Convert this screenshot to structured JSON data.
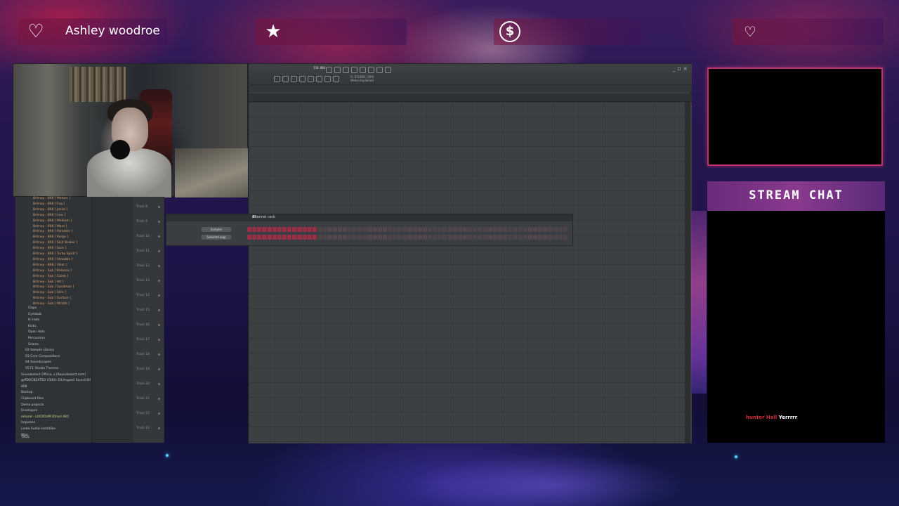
{
  "overlay": {
    "alerts": [
      {
        "icon": "heart-icon",
        "label": "Ashley woodroe"
      },
      {
        "icon": "star-icon",
        "label": ""
      },
      {
        "icon": "dollar-icon",
        "label": ""
      },
      {
        "icon": "heart-hand-icon",
        "label": ""
      }
    ]
  },
  "daw": {
    "bpm_display": "150.000",
    "hint_line1": "FL STUDIO | DPU",
    "hint_line2": "Melon Explained",
    "channel_rack": {
      "title": "Channel rack",
      "filter": "All",
      "channels": [
        {
          "name": "Sampler"
        },
        {
          "name": "Selected loop"
        }
      ]
    },
    "track_labels": [
      "Track 8",
      "Track 9",
      "Track 10",
      "Track 11",
      "Track 12",
      "Track 13",
      "Track 14",
      "Track 15",
      "Track 16",
      "Track 17",
      "Track 18",
      "Track 19",
      "Track 20",
      "Track 21",
      "Track 22",
      "Track 23"
    ],
    "browser_items": [
      {
        "label": "Britney - 808 [ Mature ]",
        "kind": "orange"
      },
      {
        "label": "Britney - 808 [ Fog ]",
        "kind": "orange"
      },
      {
        "label": "Britney - 808 [ Jovial ]",
        "kind": "orange"
      },
      {
        "label": "Britney - 808 [ Low ]",
        "kind": "orange"
      },
      {
        "label": "Britney - 808 [ Medium ]",
        "kind": "orange"
      },
      {
        "label": "Britney - 808 [ Mass ]",
        "kind": "orange"
      },
      {
        "label": "Britney - 808 [ Paradise ]",
        "kind": "orange"
      },
      {
        "label": "Britney - 808 [ Purge ]",
        "kind": "orange"
      },
      {
        "label": "Britney - 808 [ Skill Shaker ]",
        "kind": "orange"
      },
      {
        "label": "Britney - 808 [ Sore ]",
        "kind": "orange"
      },
      {
        "label": "Britney - 808 [ Turbo Spirit ]",
        "kind": "orange"
      },
      {
        "label": "Britney - 808 [ Valuable ]",
        "kind": "orange"
      },
      {
        "label": "Britney - 808 [ Valor ]",
        "kind": "orange"
      },
      {
        "label": "Britney - Sub [ Balance ]",
        "kind": "orange"
      },
      {
        "label": "Britney - Sub [ Comb ]",
        "kind": "orange"
      },
      {
        "label": "Britney - Sub [ Hit ]",
        "kind": "orange"
      },
      {
        "label": "Britney - Sub [ Sandman ]",
        "kind": "orange"
      },
      {
        "label": "Britney - Sub [ Slim ]",
        "kind": "orange"
      },
      {
        "label": "Britney - Sub [ Surface ]",
        "kind": "orange"
      },
      {
        "label": "Britney - Sub [ Wraith ]",
        "kind": "orange"
      },
      {
        "label": "Claps",
        "kind": "white"
      },
      {
        "label": "Cymbals",
        "kind": "white"
      },
      {
        "label": "Hi Hats",
        "kind": "white"
      },
      {
        "label": "Kicks",
        "kind": "white"
      },
      {
        "label": "Open Hats",
        "kind": "white"
      },
      {
        "label": "Percussion",
        "kind": "white"
      },
      {
        "label": "Snares",
        "kind": "white"
      },
      {
        "label": "02 Sample Library",
        "kind": "white"
      },
      {
        "label": "03 Core Compositions",
        "kind": "white"
      },
      {
        "label": "04 Soundscapes",
        "kind": "white"
      },
      {
        "label": "05 FL Studio Themes",
        "kind": "white"
      },
      {
        "label": "Soundselect Officia..s (Roundselect.com)",
        "kind": "white"
      },
      {
        "label": "@PDOCBEATSD 1500+ DLAngstel Sound Kit",
        "kind": "white"
      },
      {
        "label": "808",
        "kind": "white"
      },
      {
        "label": "Backup",
        "kind": "white"
      },
      {
        "label": "Clipboard files",
        "kind": "white"
      },
      {
        "label": "Demo projects",
        "kind": "white"
      },
      {
        "label": "Envelopes",
        "kind": "white"
      },
      {
        "label": "emyral - LOCKDUM [Drum Kit]",
        "kind": "green"
      },
      {
        "label": "Impulses",
        "kind": "white"
      },
      {
        "label": "Linda Audio-InstaVibe",
        "kind": "white"
      },
      {
        "label": "Misc",
        "kind": "white"
      }
    ],
    "browser_footer": "TAGS"
  },
  "chat": {
    "title": "STREAM CHAT",
    "messages": [
      {
        "user": "hunter Hall",
        "text": "Yerrrrr"
      }
    ]
  },
  "colors": {
    "accent_pink": "#c0306a",
    "chat_user": "#d22a34",
    "step_on": "#9a2f45",
    "step_off": "#5a4a50"
  }
}
